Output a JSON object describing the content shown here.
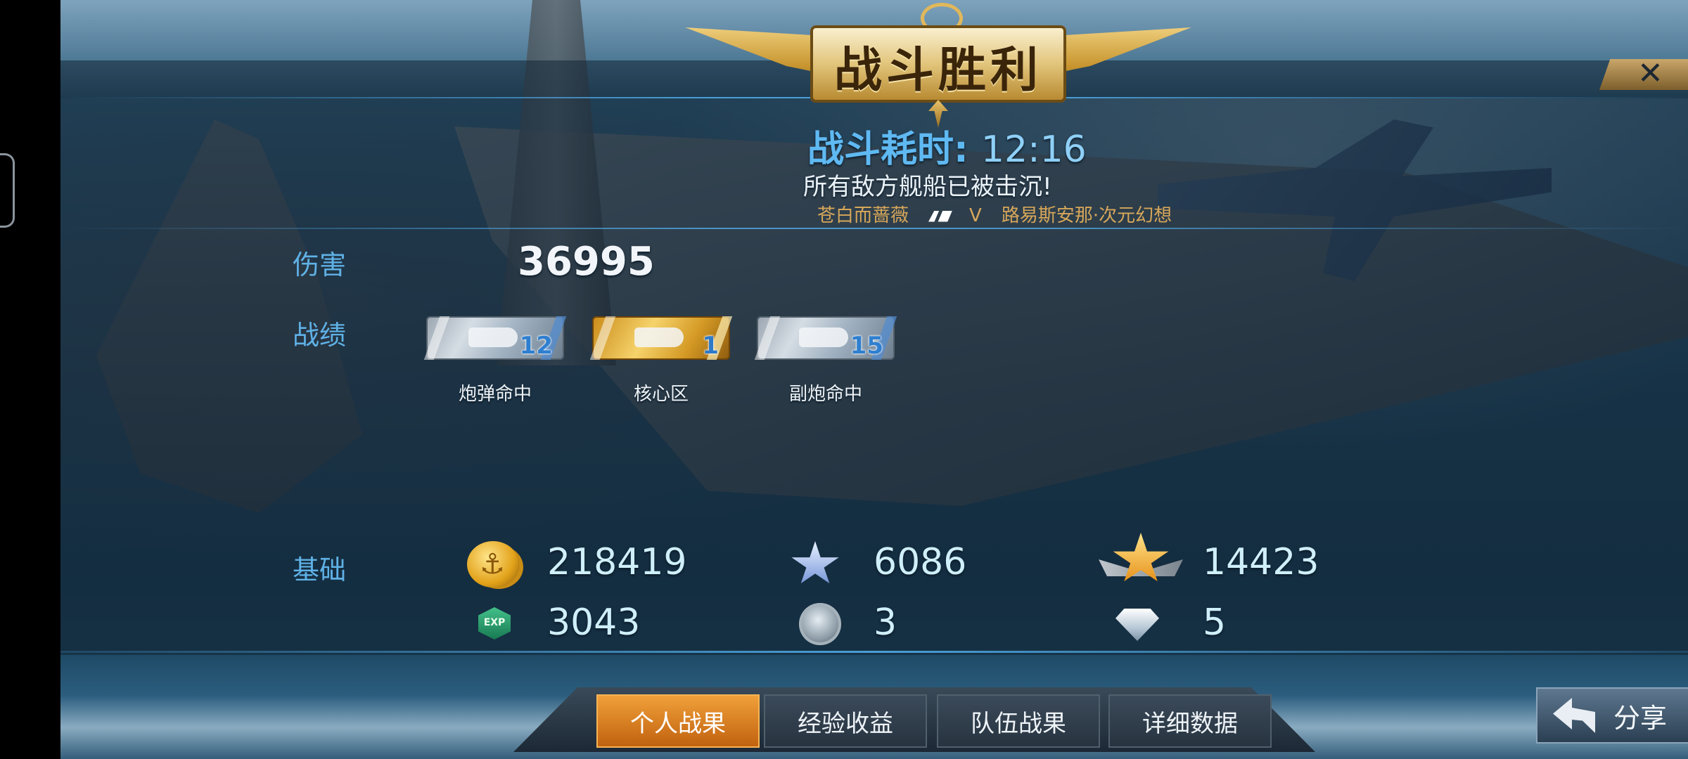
{
  "header": {
    "title": "战斗胜利",
    "duration_label": "战斗耗时:",
    "duration_value": "12:16",
    "result_message": "所有敌方舰船已被击沉!",
    "killer": "苍白而蔷薇",
    "victim_tier": "V",
    "victim": "路易斯安那·次元幻想"
  },
  "close": {
    "icon": "close-icon"
  },
  "damage": {
    "label": "伤害",
    "value": "36995"
  },
  "achievements": {
    "label": "战绩",
    "medals": [
      {
        "name": "炮弹命中",
        "count": "12",
        "style": "silver"
      },
      {
        "name": "核心区",
        "count": "1",
        "style": "gold"
      },
      {
        "name": "副炮命中",
        "count": "15",
        "style": "silver"
      }
    ]
  },
  "basic": {
    "label": "基础",
    "coins": "218419",
    "silver_star": "6086",
    "gold_star": "14423",
    "exp": "3043",
    "exp_icon_text": "EXP",
    "orb": "3",
    "diamond": "5"
  },
  "tabs": [
    {
      "label": "个人战果",
      "active": true
    },
    {
      "label": "经验收益",
      "active": false
    },
    {
      "label": "队伍战果",
      "active": false
    },
    {
      "label": "详细数据",
      "active": false
    }
  ],
  "share": {
    "label": "分享"
  },
  "colors": {
    "accent_blue": "#5fb9f2",
    "gold": "#e2a21a",
    "active_tab": "#f0a03a"
  }
}
